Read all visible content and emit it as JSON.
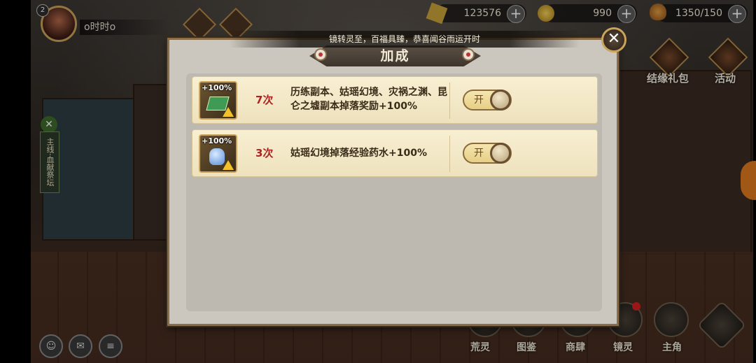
{
  "player": {
    "level": "2",
    "name": "o时时o"
  },
  "resources": [
    {
      "name": "coins",
      "value": "123576",
      "icon": "coin-stack-icon"
    },
    {
      "name": "currency",
      "value": "990",
      "icon": "gold-currency-icon"
    },
    {
      "name": "stamina",
      "value": "1350/150",
      "icon": "stamina-drumstick-icon"
    }
  ],
  "side_buttons": [
    {
      "label": "结缘礼包",
      "icon": "gift-pack-icon"
    },
    {
      "label": "活动",
      "icon": "event-icon"
    }
  ],
  "bottom_nav": [
    "荒灵",
    "图鉴",
    "商肆",
    "镜灵",
    "主角"
  ],
  "quest_tag": "主线·血献祭坛",
  "marquee": "镜转灵至，百福具臻，恭喜闻谷雨运开时",
  "dialog": {
    "title": "加成",
    "close_label": "✕",
    "items": [
      {
        "badge": "+100%",
        "count": "7次",
        "description": "历练副本、姑瑶幻境、灾祸之渊、昆仑之墟副本掉落奖励+100%",
        "toggle_label": "开",
        "icon": "reward-boost-icon"
      },
      {
        "badge": "+100%",
        "count": "3次",
        "description": "姑瑶幻境掉落经验药水+100%",
        "toggle_label": "开",
        "icon": "exp-potion-boost-icon"
      }
    ]
  },
  "colors": {
    "accent_gold": "#c9a45a",
    "count_red": "#b02222",
    "row_bg": "#f8efd2"
  }
}
